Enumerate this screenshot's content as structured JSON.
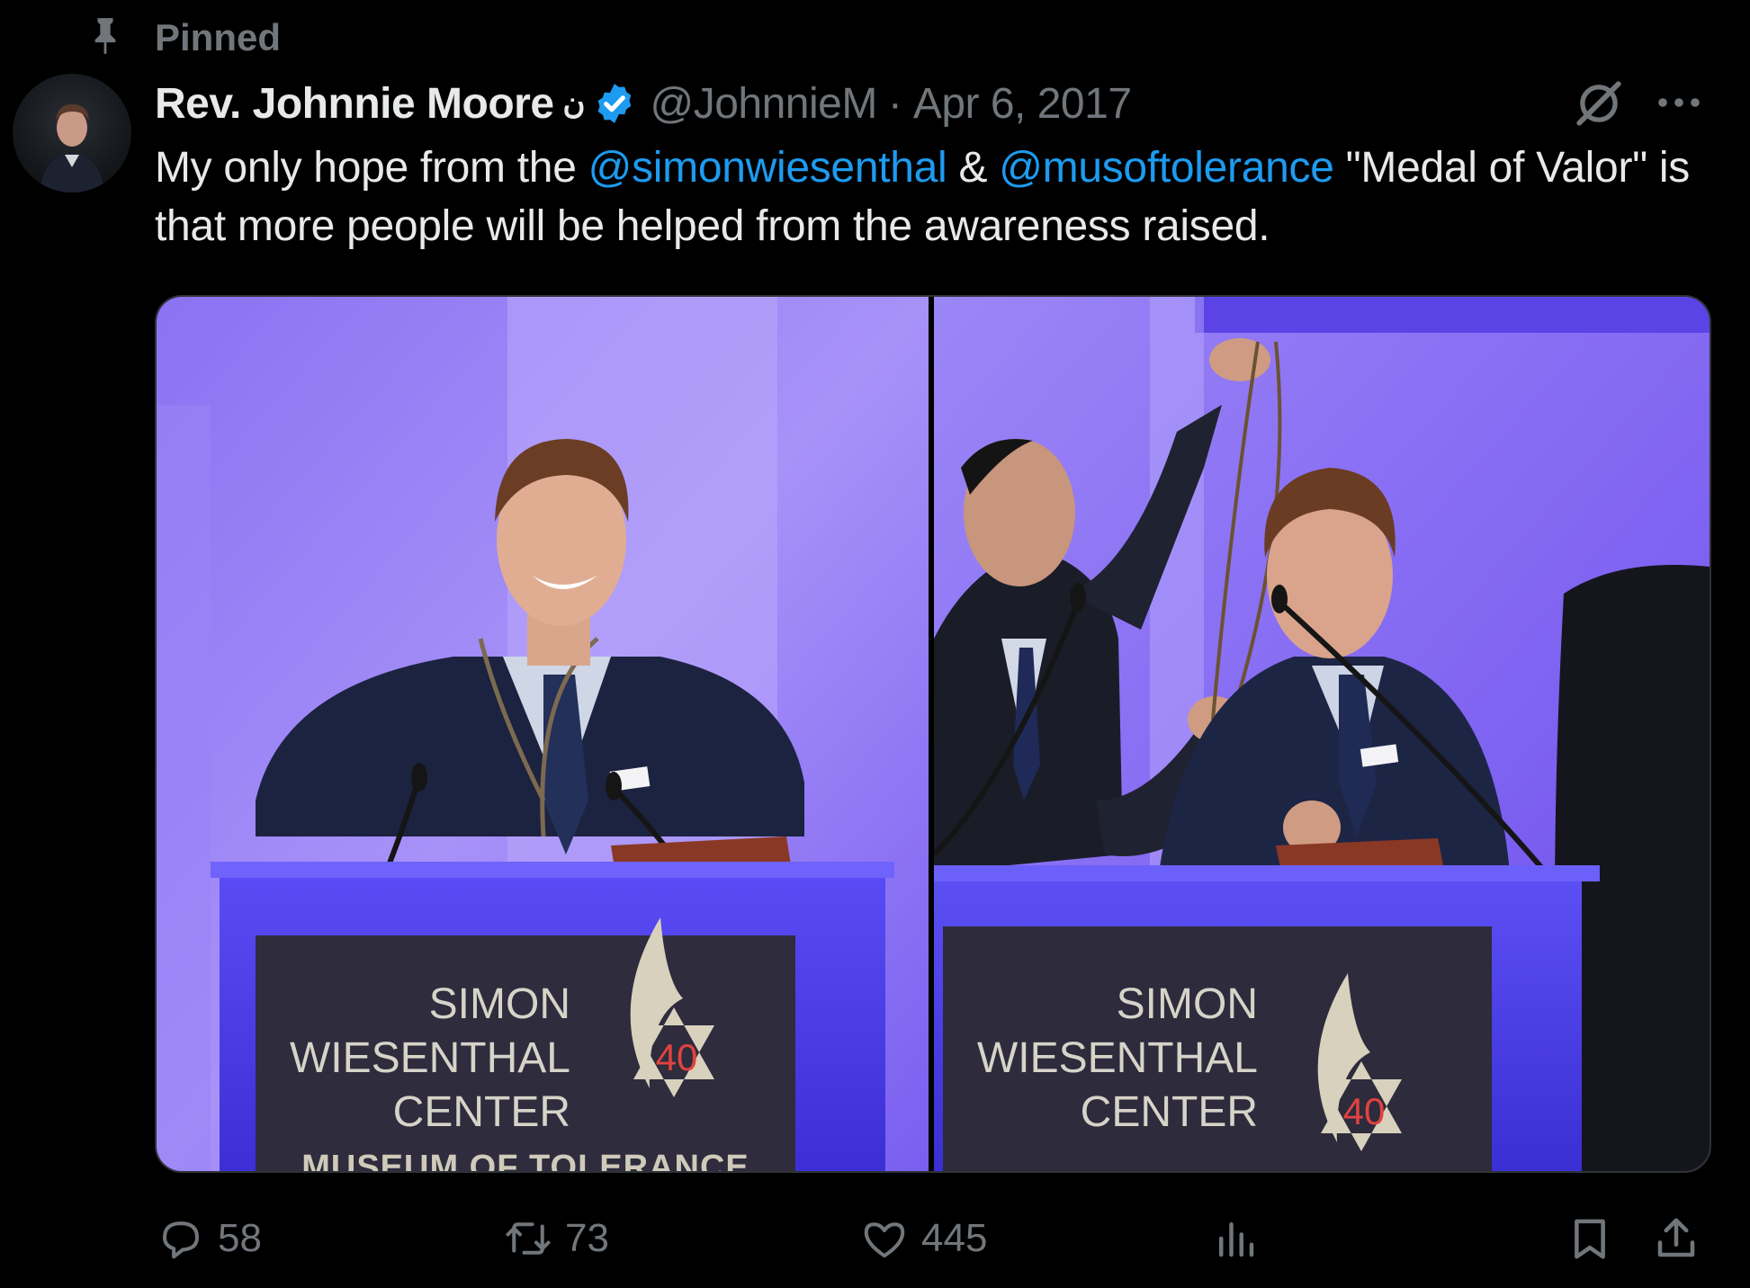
{
  "pinned": {
    "label": "Pinned",
    "icon": "pin-icon"
  },
  "author": {
    "display_name": "Rev. Johnnie Moore",
    "name_glyph": "ن",
    "verified_icon": "verified-badge-icon",
    "handle": "@JohnnieM",
    "separator": "·",
    "date": "Apr 6, 2017",
    "avatar_icon": "avatar"
  },
  "tweet": {
    "text_1": "My only hope from the ",
    "mention_1": "@simonwiesenthal",
    "text_2": " & ",
    "mention_2": "@musoftolerance",
    "text_3": " \"Medal of Valor\" is that more people will be helped from the awareness raised."
  },
  "media": {
    "left_photo": {
      "podium_line1": "SIMON",
      "podium_line2": "WIESENTHAL",
      "podium_line3": "CENTER",
      "podium_number": "40",
      "podium_footer": "MUSEUM OF TOLERANCE"
    },
    "right_photo": {
      "podium_line1": "SIMON",
      "podium_line2": "WIESENTHAL",
      "podium_line3": "CENTER",
      "podium_number": "40"
    }
  },
  "actions": {
    "reply": {
      "icon": "reply-icon",
      "count": "58"
    },
    "repost": {
      "icon": "repost-icon",
      "count": "73"
    },
    "like": {
      "icon": "heart-icon",
      "count": "445"
    },
    "views": {
      "icon": "analytics-icon"
    },
    "bookmark": {
      "icon": "bookmark-icon"
    },
    "share": {
      "icon": "share-icon"
    }
  },
  "colors": {
    "background": "#000000",
    "text_primary": "#e7e9ea",
    "text_secondary": "#71767b",
    "link": "#1d9bf0",
    "verified": "#1d9bf0"
  }
}
